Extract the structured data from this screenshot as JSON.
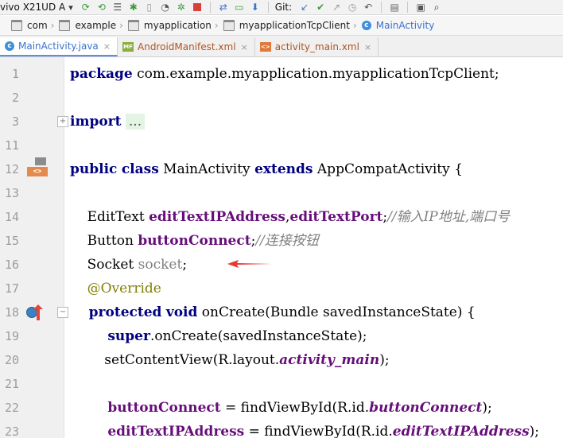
{
  "toolbar": {
    "device_label": "vivo X21UD A",
    "git_label": "Git:",
    "icons": [
      "sync-icon",
      "sync-back-icon",
      "list-icon",
      "bug-icon",
      "device-icon",
      "gauge-icon",
      "debug-icon",
      "stop-icon",
      "project-sync-icon",
      "avd-icon",
      "sdk-icon",
      "git-pull-icon",
      "git-commit-icon",
      "git-push-icon",
      "history-icon",
      "undo-icon",
      "folder-icon",
      "window-icon",
      "search-icon"
    ]
  },
  "breadcrumb": [
    "com",
    "example",
    "myapplication",
    "myapplicationTcpClient",
    "MainActivity"
  ],
  "tabs": [
    {
      "label": "MainActivity.java",
      "icon": "class-icon",
      "active": true
    },
    {
      "label": "AndroidManifest.xml",
      "icon": "manifest-icon",
      "active": false
    },
    {
      "label": "activity_main.xml",
      "icon": "xml-icon",
      "active": false
    }
  ],
  "tab_icon_text": {
    "mf": "MF"
  },
  "editor": {
    "lines": [
      {
        "num": "1"
      },
      {
        "num": "2"
      },
      {
        "num": "3"
      },
      {
        "num": "11"
      },
      {
        "num": "12"
      },
      {
        "num": "13"
      },
      {
        "num": "14"
      },
      {
        "num": "15"
      },
      {
        "num": "16"
      },
      {
        "num": "17"
      },
      {
        "num": "18"
      },
      {
        "num": "19"
      },
      {
        "num": "20"
      },
      {
        "num": "21"
      },
      {
        "num": "22"
      },
      {
        "num": "23"
      }
    ],
    "code": {
      "l1_kw": "package",
      "l1_rest": " com.example.myapplication.myapplicationTcpClient;",
      "l3_kw": "import",
      "l3_dots": "...",
      "l12_kw1": "public",
      "l12_kw2": "class",
      "l12_name": " MainActivity ",
      "l12_kw3": "extends",
      "l12_rest": " AppCompatActivity {",
      "l14_type": "    EditText ",
      "l14_f1": "editTextIPAddress",
      "l14_comma": ",",
      "l14_f2": "editTextPort",
      "l14_semi": ";",
      "l14_comment": "//输入IP地址,端口号",
      "l15_type": "    Button ",
      "l15_f": "buttonConnect",
      "l15_semi": ";",
      "l15_comment": "//连接按钮",
      "l16_type": "    Socket ",
      "l16_f": "socket",
      "l16_semi": ";",
      "l17_ann": "    @Override",
      "l18_kw1": "    protected",
      "l18_kw2": "void",
      "l18_rest": " onCreate(Bundle savedInstanceState) {",
      "l19_kw": "        super",
      "l19_rest": ".onCreate(savedInstanceState);",
      "l20_pre": "        setContentView(R.layout.",
      "l20_sfi": "activity_main",
      "l20_post": ");",
      "l22_f": "        buttonConnect",
      "l22_mid": " = findViewById(R.id.",
      "l22_sfi": "buttonConnect",
      "l22_post": ");",
      "l23_f": "        editTextIPAddress",
      "l23_mid": " = findViewById(R.id.",
      "l23_sfi": "editTextIPAddress",
      "l23_post": ");"
    },
    "gutter_icons": {
      "l12": "<>"
    }
  },
  "colors": {
    "keyword": "#000080",
    "field": "#660e7a",
    "annotation": "#808000",
    "comment": "#808080",
    "arrow": "#e53935",
    "tab_text": "#3d73c9"
  }
}
